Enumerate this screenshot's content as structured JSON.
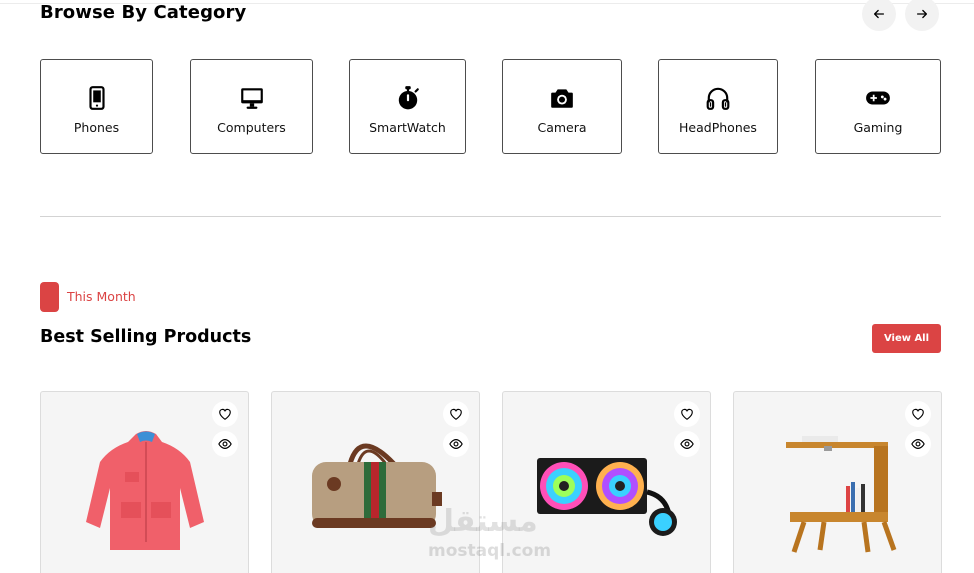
{
  "categories_section": {
    "title": "Browse By Category",
    "prev_arrow": "←",
    "next_arrow": "→",
    "items": [
      {
        "label": "Phones",
        "icon": "phone-icon"
      },
      {
        "label": "Computers",
        "icon": "computer-icon"
      },
      {
        "label": "SmartWatch",
        "icon": "smartwatch-icon"
      },
      {
        "label": "Camera",
        "icon": "camera-icon"
      },
      {
        "label": "HeadPhones",
        "icon": "headphones-icon"
      },
      {
        "label": "Gaming",
        "icon": "gamepad-icon"
      }
    ]
  },
  "best_selling": {
    "tag": "This Month",
    "title": "Best Selling Products",
    "view_all_label": "View All",
    "accent_color": "#db4444",
    "products": [
      {
        "image": "red-jacket",
        "icons": [
          "heart-icon",
          "eye-icon"
        ]
      },
      {
        "image": "gucci-bag",
        "icons": [
          "heart-icon",
          "eye-icon"
        ]
      },
      {
        "image": "rgb-cpu-cooler",
        "icons": [
          "heart-icon",
          "eye-icon"
        ]
      },
      {
        "image": "wooden-side-table",
        "icons": [
          "heart-icon",
          "eye-icon"
        ]
      }
    ]
  },
  "watermark": {
    "arabic": "مستقل",
    "latin": "mostaql.com"
  }
}
